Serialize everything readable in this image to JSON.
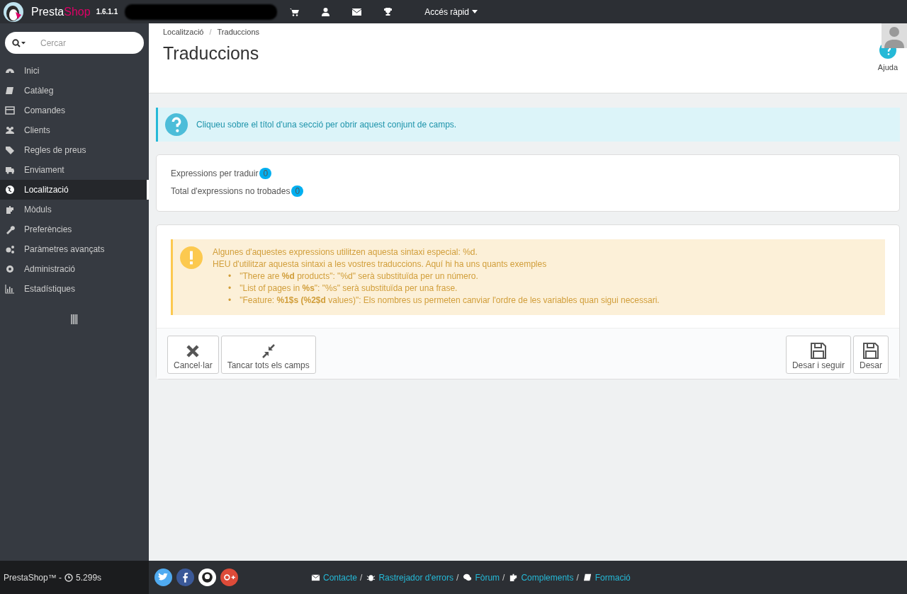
{
  "header": {
    "brand_first": "Presta",
    "brand_second": "Shop",
    "version": "1.6.1.1",
    "quick_access": "Accés ràpid"
  },
  "sidebar": {
    "search": {
      "placeholder": "Cercar"
    },
    "items": [
      {
        "label": "Inici",
        "selected": false
      },
      {
        "label": "Catàleg",
        "selected": false
      },
      {
        "label": "Comandes",
        "selected": false
      },
      {
        "label": "Clients",
        "selected": false
      },
      {
        "label": "Regles de preus",
        "selected": false
      },
      {
        "label": "Enviament",
        "selected": false
      },
      {
        "label": "Localització",
        "selected": true
      },
      {
        "label": "Mòduls",
        "selected": false
      },
      {
        "label": "Preferències",
        "selected": false
      },
      {
        "label": "Paràmetres avançats",
        "selected": false
      },
      {
        "label": "Administració",
        "selected": false
      },
      {
        "label": "Estadístiques",
        "selected": false
      }
    ]
  },
  "page_header": {
    "breadcrumb": [
      "Localització",
      "Traduccions"
    ],
    "breadcrumb_separator": "/",
    "title": "Traduccions",
    "help": "Ajuda"
  },
  "info_alert": "Cliqueu sobre el títol d'una secció per obrir aquest conjunt de camps.",
  "stats": [
    {
      "label": "Expressions per traduir",
      "count": "0"
    },
    {
      "label": "Total d'expressions no trobades",
      "count": "0"
    }
  ],
  "warning": {
    "lines": [
      "Algunes d'aquestes expressions utilitzen aquesta sintaxi especial: %d.",
      "HEU d'utilitzar aquesta sintaxi a les vostres traduccions. Aquí hi ha uns quants exemples"
    ],
    "examples": [
      {
        "bullet": "•",
        "text": "\"There are **%d** products\": \"%d\" serà substituïda per un número."
      },
      {
        "bullet": "•",
        "text": "\"List of pages in **%s**\": \"%s\" serà substituïda per una frase."
      },
      {
        "bullet": "•",
        "text": "\"Feature: **%1$s (%2$d** values)\": Els nombres us permeten canviar l'ordre de les variables quan sigui necessari."
      }
    ]
  },
  "buttons_left": [
    "Cancel·lar",
    "Tancar tots els camps"
  ],
  "buttons_right": [
    "Desar i seguir",
    "Desar"
  ],
  "footer": {
    "brand": "PrestaShop™ -",
    "time": "5.299s",
    "links": [
      {
        "label": "Contacte",
        "separator": "/"
      },
      {
        "label": "Rastrejador d'errors",
        "separator": "/"
      },
      {
        "label": "Fòrum",
        "separator": "/"
      },
      {
        "label": "Complements",
        "separator": "/"
      },
      {
        "label": "Formació"
      }
    ]
  }
}
